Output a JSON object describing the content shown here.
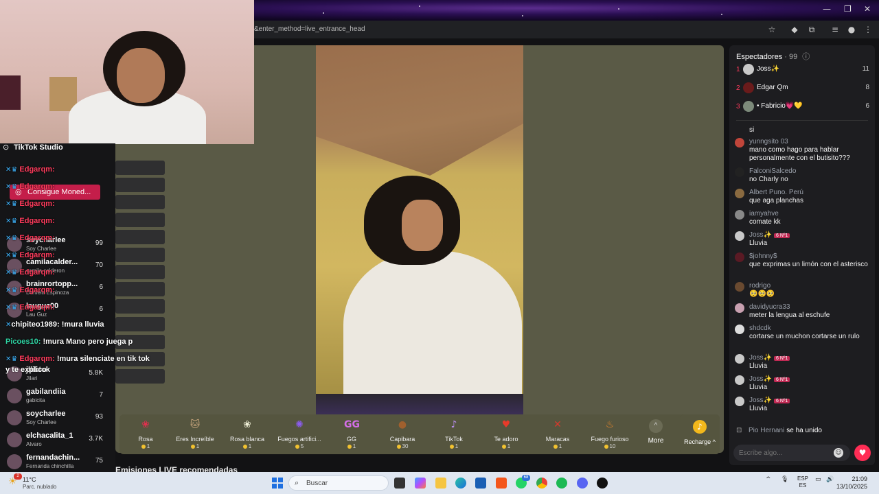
{
  "browser": {
    "url": "&enter_method=live_entrance_head"
  },
  "studio": {
    "title": "TikTok Studio",
    "coins_button": "Consigue Moned..."
  },
  "overlay_chat": [
    {
      "user": "Edgarqm:",
      "msg": ""
    },
    {
      "user": "Edgarqm:",
      "msg": ""
    },
    {
      "user": "Edgarqm:",
      "msg": ""
    },
    {
      "user": "Edgarqm:",
      "msg": ""
    },
    {
      "user": "Edgarqm:",
      "msg": ""
    },
    {
      "user": "Edgarqm:",
      "msg": ""
    },
    {
      "user": "Edgarqm:",
      "msg": ""
    },
    {
      "user": "Edgarqm:",
      "msg": ""
    },
    {
      "user": "Edgarqm:",
      "msg": ""
    },
    {
      "user": "chipiteo1989:",
      "msg": "!mura lluvia"
    },
    {
      "user": "Picoes10:",
      "msg": "!mura Mano pero juega p"
    },
    {
      "user": "Edgarqm:",
      "msg": "!mura silenciate en tik tok"
    },
    {
      "user": "",
      "msg": "y te explico"
    }
  ],
  "leaderboard": [
    {
      "name": "soycharlee",
      "sub": "Soy Charlee",
      "score": "99"
    },
    {
      "name": "camilacalder...",
      "sub": "camila calderon",
      "score": "70"
    },
    {
      "name": "brainrortopp...",
      "sub": "Daniela Espinoza",
      "score": "6"
    },
    {
      "name": "lauguz00",
      "sub": "Lau Guz",
      "score": "6"
    },
    {
      "name": "jlliktok",
      "sub": "Jilari",
      "score": "5.8K"
    },
    {
      "name": "gabilandiia",
      "sub": "gabicita",
      "score": "7"
    },
    {
      "name": "soycharlee",
      "sub": "Soy Charlee",
      "score": "93"
    },
    {
      "name": "elchacalita_1",
      "sub": "Alvaro",
      "score": "3.7K"
    },
    {
      "name": "fernandachin...",
      "sub": "Fernanda chinchilla",
      "score": "75"
    }
  ],
  "gifts": [
    {
      "name": "Rosa",
      "cost": "1",
      "icon": "rose-icon",
      "glyph": "❀",
      "color": "#e0304e"
    },
    {
      "name": "Eres Increíble",
      "cost": "1",
      "icon": "cat-icon",
      "glyph": "🐱",
      "color": "#c7a47c"
    },
    {
      "name": "Rosa blanca",
      "cost": "1",
      "icon": "white-rose-icon",
      "glyph": "❀",
      "color": "#f1f1d8"
    },
    {
      "name": "Fuegos artifici...",
      "cost": "5",
      "icon": "fireworks-icon",
      "glyph": "✺",
      "color": "#8c5cf0"
    },
    {
      "name": "GG",
      "cost": "1",
      "icon": "gg-icon",
      "glyph": "G",
      "color": "#d46ee8"
    },
    {
      "name": "Capibara",
      "cost": "30",
      "icon": "capybara-icon",
      "glyph": "●",
      "color": "#a0602e"
    },
    {
      "name": "TikTok",
      "cost": "1",
      "icon": "tiktok-icon",
      "glyph": "♪",
      "color": "#b98ef0"
    },
    {
      "name": "Te adoro",
      "cost": "1",
      "icon": "heart-face-icon",
      "glyph": "♥",
      "color": "#e83a2a"
    },
    {
      "name": "Maracas",
      "cost": "1",
      "icon": "maracas-icon",
      "glyph": "✕",
      "color": "#d8392c"
    },
    {
      "name": "Fuego furioso",
      "cost": "10",
      "icon": "fire-icon",
      "glyph": "♨",
      "color": "#f08a2a"
    }
  ],
  "more_label": "More",
  "recharge_label": "Recharge",
  "recommended_title": "Emisiones LIVE recomendadas",
  "viewers": {
    "title": "Espectadores",
    "count": "· 99",
    "top": [
      {
        "rank": "1",
        "name": "Joss✨",
        "score": "11"
      },
      {
        "rank": "2",
        "name": "Edgar Qm",
        "score": "8"
      },
      {
        "rank": "3",
        "name": "• Fabricio💗💛",
        "score": "6"
      }
    ]
  },
  "chat": [
    {
      "user": "",
      "badge": "",
      "text": "si"
    },
    {
      "user": "yunngsito 03",
      "badge": "",
      "text": "mano como hago para hablar personalmente con el butisito???"
    },
    {
      "user": "FalconiSalcedo",
      "badge": "",
      "text": "no Charly no"
    },
    {
      "user": "Albert Puno. Perú",
      "badge": "",
      "text": "que aga planchas"
    },
    {
      "user": "iamyahve",
      "badge": "",
      "text": "comate kk"
    },
    {
      "user": "Joss✨",
      "badge": "6 Nº1",
      "text": "Lluvia"
    },
    {
      "user": "$johnny$",
      "badge": "",
      "text": "que exprimas un limón con el asterisco"
    },
    {
      "user": "rodrigo",
      "badge": "",
      "text": "🥺🥺🥺"
    },
    {
      "user": "davidyucra33",
      "badge": "",
      "text": "meter la lengua al eschufe"
    },
    {
      "user": "shdcdk",
      "badge": "",
      "text": "cortarse un muchon cortarse un rulo"
    },
    {
      "user": "Joss✨",
      "badge": "6 Nº1",
      "text": "Lluvia"
    },
    {
      "user": "Joss✨",
      "badge": "6 Nº1",
      "text": "Lluvia"
    },
    {
      "user": "Joss✨",
      "badge": "6 Nº1",
      "text": "Lluvia"
    }
  ],
  "joined": {
    "user": "Pio Hernani",
    "text": "se ha unido"
  },
  "chat_placeholder": "Escribe algo...",
  "taskbar": {
    "temp": "11°C",
    "weather": "Parc. nublado",
    "weather_badge": "2",
    "search": "Buscar",
    "lang1": "ESP",
    "lang2": "ES",
    "time": "21:09",
    "date": "13/10/2025",
    "badge_whatsapp": "68"
  }
}
